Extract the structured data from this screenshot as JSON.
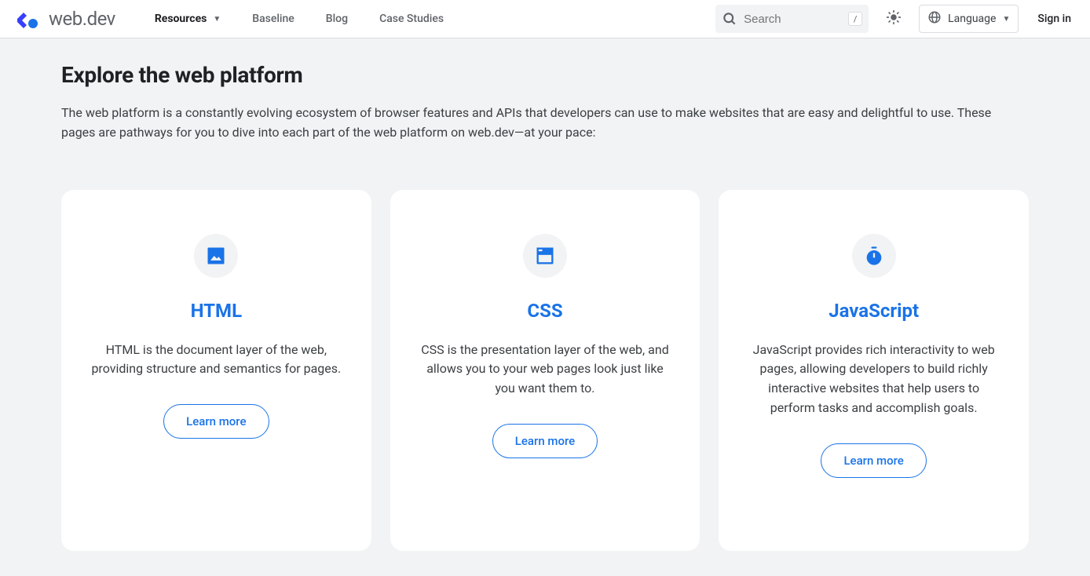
{
  "header": {
    "logo_text": "web.dev",
    "nav": [
      {
        "label": "Resources",
        "active": true,
        "dropdown": true
      },
      {
        "label": "Baseline",
        "active": false,
        "dropdown": false
      },
      {
        "label": "Blog",
        "active": false,
        "dropdown": false
      },
      {
        "label": "Case Studies",
        "active": false,
        "dropdown": false
      }
    ],
    "search_placeholder": "Search",
    "search_shortcut": "/",
    "language_label": "Language",
    "signin_label": "Sign in"
  },
  "main": {
    "title": "Explore the web platform",
    "description": "The web platform is a constantly evolving ecosystem of browser features and APIs that developers can use to make websites that are easy and delightful to use. These pages are pathways for you to dive into each part of the web platform on web.dev—at your pace:",
    "cards": [
      {
        "title": "HTML",
        "description": "HTML is the document layer of the web, providing structure and semantics for pages.",
        "button_label": "Learn more",
        "icon": "image-icon"
      },
      {
        "title": "CSS",
        "description": "CSS is the presentation layer of the web, and allows you to your web pages look just like you want them to.",
        "button_label": "Learn more",
        "icon": "web-icon"
      },
      {
        "title": "JavaScript",
        "description": "JavaScript provides rich interactivity to web pages, allowing developers to build richly interactive websites that help users to perform tasks and accomplish goals.",
        "button_label": "Learn more",
        "icon": "timer-icon"
      }
    ]
  }
}
